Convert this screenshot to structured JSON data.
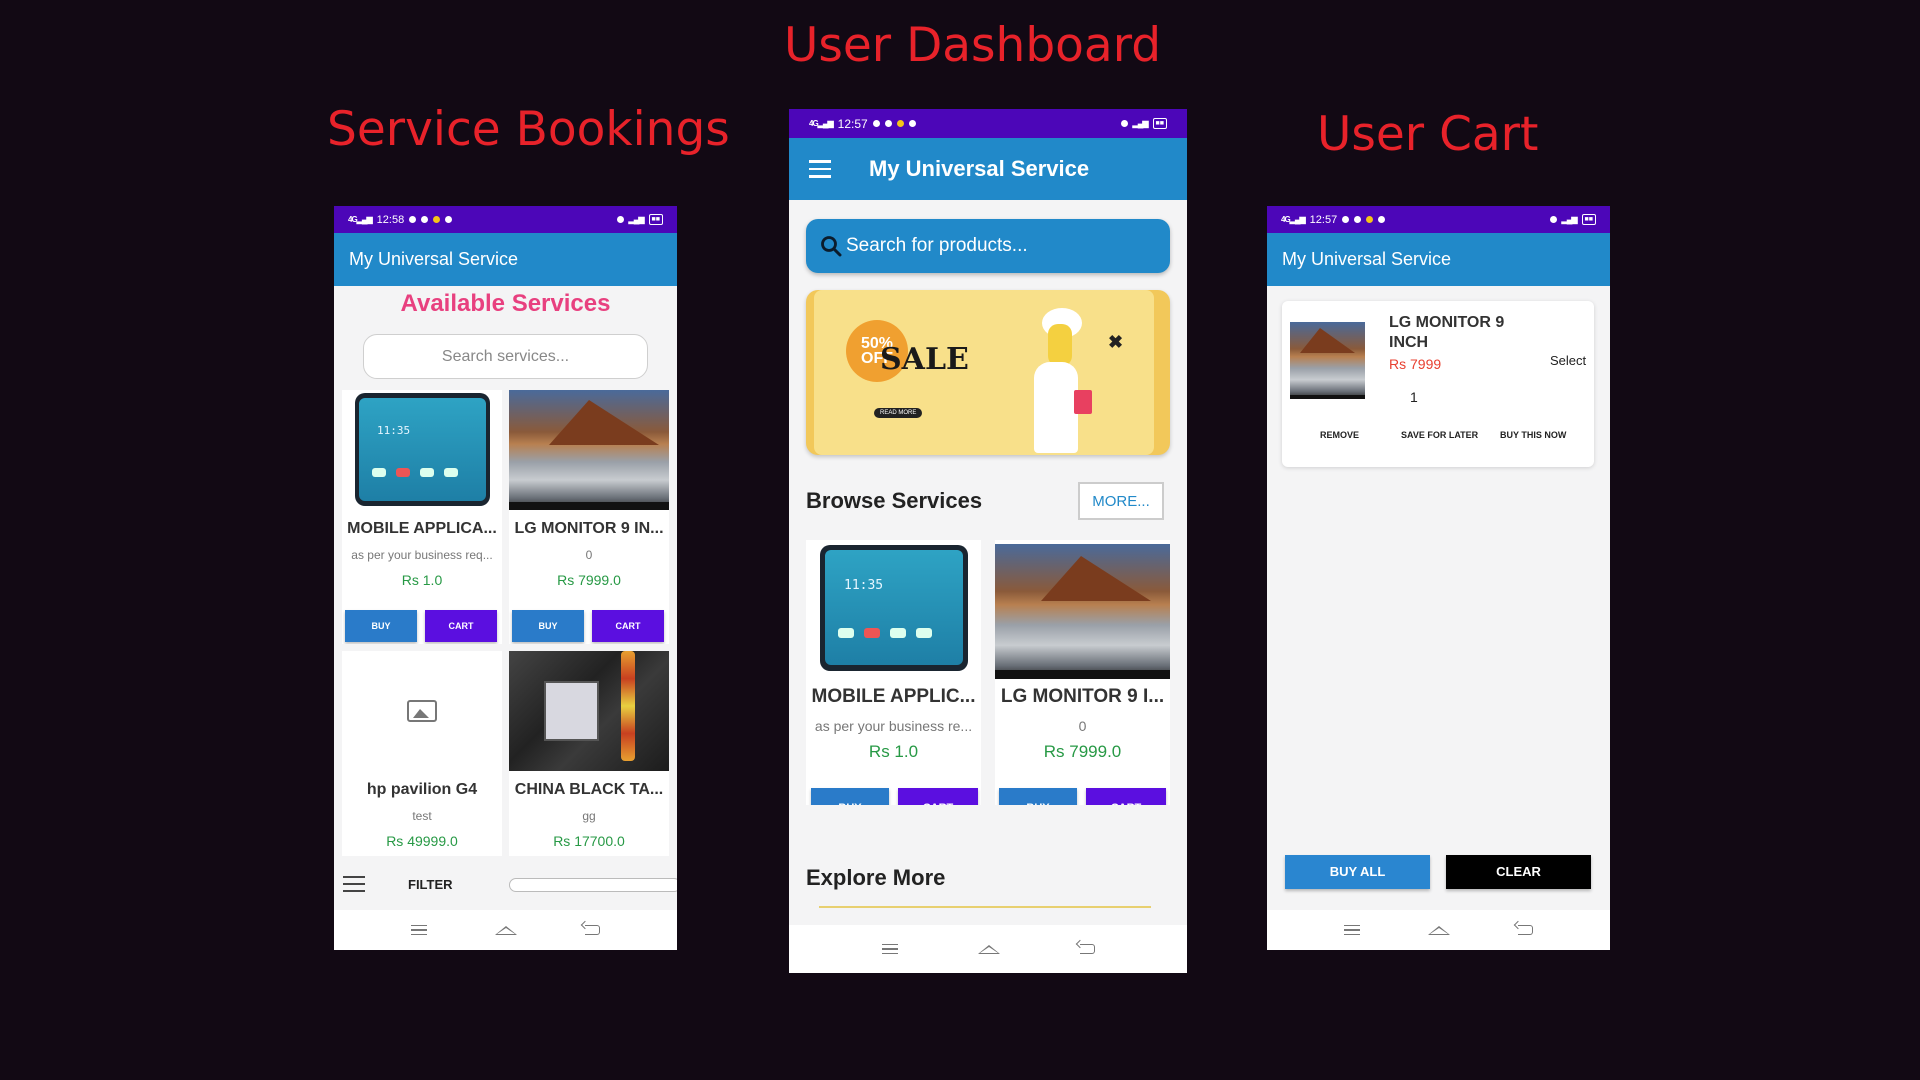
{
  "headings": {
    "dashboard": "User Dashboard",
    "bookings": "Service Bookings",
    "cart": "User Cart"
  },
  "app_title": "My Universal Service",
  "colors": {
    "accent": "#2189c9",
    "status_bar": "#4c06b8",
    "cart_button": "#5b0fe0",
    "price": "#279945",
    "heading": "#e8222a"
  },
  "bookings": {
    "status_time": "12:58",
    "page_title": "Available Services",
    "search_placeholder": "Search services...",
    "cards": [
      {
        "title": "MOBILE APPLICA...",
        "desc": "as per your business req...",
        "price": "Rs 1.0",
        "buy": "BUY",
        "cart": "CART",
        "image": "phone-image"
      },
      {
        "title": "LG MONITOR 9 IN...",
        "desc": "0",
        "price": "Rs 7999.0",
        "buy": "BUY",
        "cart": "CART",
        "image": "monitor-image"
      },
      {
        "title": "hp pavilion G4",
        "desc": "test",
        "price": "Rs 49999.0",
        "image": "image-placeholder-icon"
      },
      {
        "title": "CHINA BLACK TA...",
        "desc": "gg",
        "price": "Rs 17700.0",
        "image": "router-image"
      }
    ],
    "filter_label": "FILTER"
  },
  "dashboard": {
    "status_time": "12:57",
    "search_placeholder": "Search for products...",
    "banner": {
      "discount": "50% OFF",
      "sale": "SALE",
      "cta": "READ MORE"
    },
    "browse_title": "Browse Services",
    "more_label": "MORE...",
    "cards": [
      {
        "title": "MOBILE APPLIC...",
        "desc": "as per your business re...",
        "price": "Rs 1.0",
        "buy": "BUY",
        "cart": "CART",
        "image": "phone-image"
      },
      {
        "title": "LG MONITOR 9 I...",
        "desc": "0",
        "price": "Rs 7999.0",
        "buy": "BUY",
        "cart": "CART",
        "image": "monitor-image"
      }
    ],
    "explore_title": "Explore More"
  },
  "cart": {
    "status_time": "12:57",
    "item": {
      "name": "LG MONITOR 9 INCH",
      "price": "Rs 7999",
      "select": "Select",
      "quantity": "1",
      "remove": "REMOVE",
      "save_later": "SAVE FOR LATER",
      "buy_now": "BUY THIS NOW"
    },
    "buy_all": "BUY ALL",
    "clear": "CLEAR"
  }
}
